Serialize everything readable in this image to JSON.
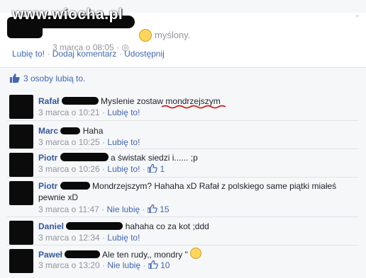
{
  "watermark": "www.wiocha.pl",
  "post": {
    "text_fragment": "myślony.",
    "timestamp": "3 marca o 08:05",
    "privacy_dot": "·",
    "actions": [
      "Lubię to!",
      "Dodaj komentarz",
      "Udostępnij"
    ],
    "action_sep": " · "
  },
  "likes": {
    "text": "3 osoby lubią to."
  },
  "comments": [
    {
      "author": "Rafał",
      "text": "Myslenie zostaw mondrzejszym",
      "time": "3 marca o 10:21",
      "like_label": "Lubię to!",
      "likes": ""
    },
    {
      "author": "Marc",
      "text": "Haha",
      "time": "3 marca o 10:25",
      "like_label": "Lubię to!",
      "likes": ""
    },
    {
      "author": "Piotr",
      "text": "a świstak siedzi i...... ;p",
      "time": "3 marca o 10:26",
      "like_label": "Lubię to!",
      "likes": "1"
    },
    {
      "author": "Piotr",
      "text": "Mondrzejszym? Hahaha xD Rafał z polskiego same piątki miałeś",
      "text2": "pewnie xD",
      "time": "3 marca o 11:47",
      "like_label": "Nie lubię",
      "likes": "15"
    },
    {
      "author": "Daniel",
      "text": "hahaha co za kot ;ddd",
      "time": "3 marca o 12:34",
      "like_label": "Lubię to!",
      "likes": ""
    },
    {
      "author": "Paweł",
      "text": "Ale ten rudy,, mondry \"",
      "time": "3 marca o 13:20",
      "like_label": "Nie lubię",
      "likes": "10"
    }
  ],
  "meta_sep": " · ",
  "colors": {
    "link": "#4267b2",
    "author": "#365899",
    "muted": "#90949c",
    "panel": "#f6f7f9",
    "underline": "#d21a1a"
  }
}
